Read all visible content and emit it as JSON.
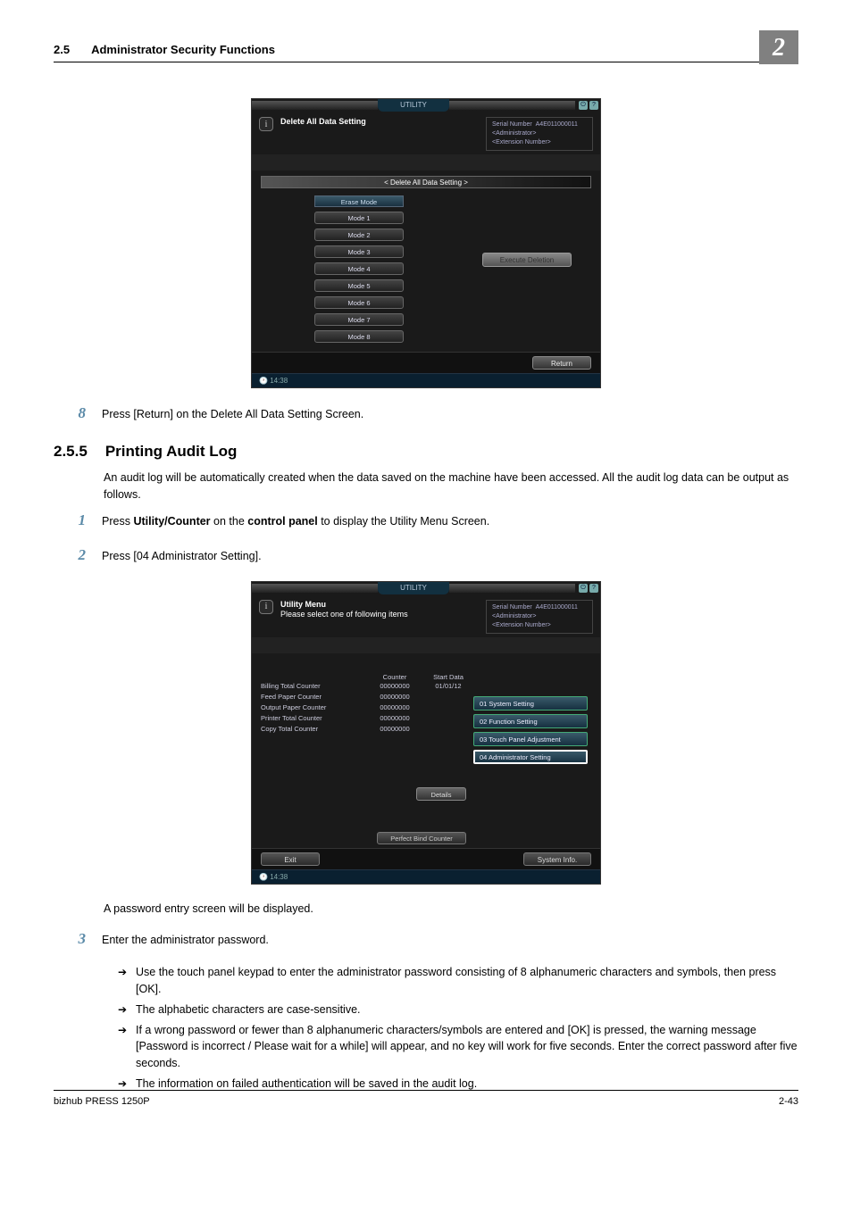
{
  "header": {
    "section_num": "2.5",
    "section_title": "Administrator Security Functions",
    "chapter": "2"
  },
  "shot1": {
    "tab_label": "UTILITY",
    "title": "Delete All Data Setting",
    "serial_label": "Serial Number",
    "serial_value": "A4E011000011",
    "admin_line": "<Administrator>",
    "ext_line": "<Extension Number>",
    "section_header": "< Delete All Data Setting >",
    "mode_header": "Erase Mode",
    "modes": [
      "Mode 1",
      "Mode 2",
      "Mode 3",
      "Mode 4",
      "Mode 5",
      "Mode 6",
      "Mode 7",
      "Mode 8"
    ],
    "execute_btn": "Execute Deletion",
    "return_btn": "Return",
    "clock": "14:38"
  },
  "step8": {
    "num": "8",
    "text": "Press [Return] on the Delete All Data Setting Screen."
  },
  "section": {
    "num": "2.5.5",
    "title": "Printing Audit Log",
    "intro": "An audit log will be automatically created when the data saved on the machine have been accessed. All the audit log data can be output as follows."
  },
  "step1": {
    "num": "1",
    "pre": "Press ",
    "b1": "Utility/Counter",
    "mid": " on the ",
    "b2": "control panel",
    "post": " to display the Utility Menu Screen."
  },
  "step2": {
    "num": "2",
    "text": "Press [04 Administrator Setting]."
  },
  "shot2": {
    "tab_label": "UTILITY",
    "title_line1": "Utility Menu",
    "title_line2": "Please select one of following items",
    "serial_label": "Serial Number",
    "serial_value": "A4E011000011",
    "admin_line": "<Administrator>",
    "ext_line": "<Extension Number>",
    "col_counter": "Counter",
    "col_start": "Start Data",
    "rows": [
      {
        "name": "Billing Total Counter",
        "counter": "00000000",
        "start": "01/01/12"
      },
      {
        "name": "Feed Paper Counter",
        "counter": "00000000",
        "start": ""
      },
      {
        "name": "Output Paper Counter",
        "counter": "00000000",
        "start": ""
      },
      {
        "name": "Printer Total Counter",
        "counter": "00000000",
        "start": ""
      },
      {
        "name": "Copy Total Counter",
        "counter": "00000000",
        "start": ""
      }
    ],
    "menu": [
      "01 System Setting",
      "02 Function Setting",
      "03 Touch Panel Adjustment",
      "04 Administrator Setting"
    ],
    "details_btn": "Details",
    "perfect_btn": "Perfect Bind Counter",
    "exit_btn": "Exit",
    "sys_btn": "System Info.",
    "clock": "14:38"
  },
  "after_shot2": "A password entry screen will be displayed.",
  "step3": {
    "num": "3",
    "text": "Enter the administrator password.",
    "bullets": [
      "Use the touch panel keypad to enter the administrator password consisting of 8 alphanumeric characters and symbols, then press [OK].",
      "The alphabetic characters are case-sensitive.",
      "If a wrong password or fewer than 8 alphanumeric characters/symbols are entered and [OK] is pressed, the warning message [Password is incorrect / Please wait for a while] will appear, and no key will work for five seconds. Enter the correct password after five seconds.",
      "The information on failed authentication will be saved in the audit log."
    ]
  },
  "footer": {
    "left": "bizhub PRESS 1250P",
    "right": "2-43"
  }
}
